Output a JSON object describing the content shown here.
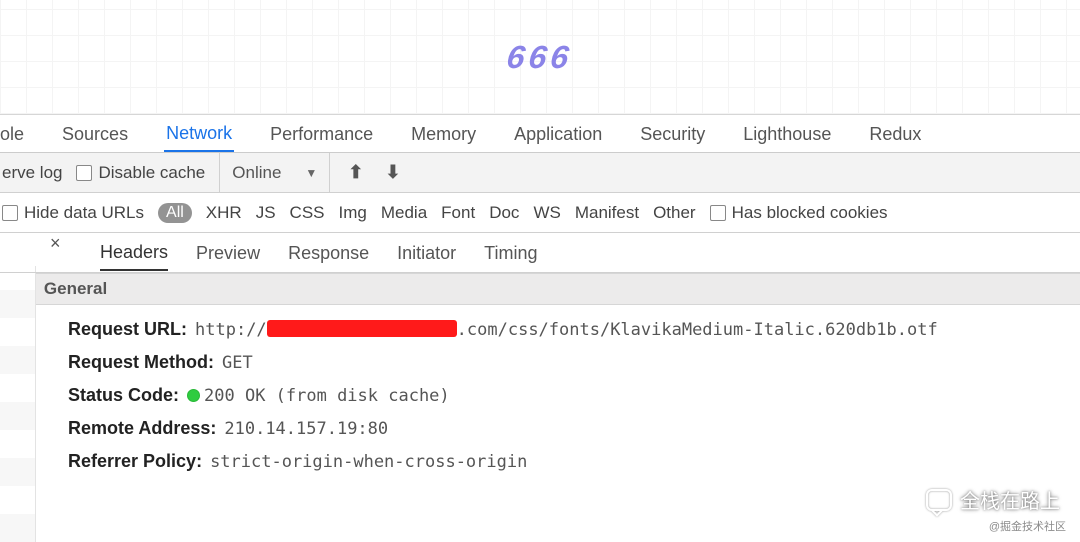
{
  "preview": {
    "text": "666"
  },
  "devtools_tabs": {
    "console_cut": "ole",
    "sources": "Sources",
    "network": "Network",
    "performance": "Performance",
    "memory": "Memory",
    "application": "Application",
    "security": "Security",
    "lighthouse": "Lighthouse",
    "redux": "Redux"
  },
  "toolbar": {
    "preserve_cut": "erve log",
    "disable_cache": "Disable cache",
    "throttling": "Online",
    "upload_icon": "⬆",
    "download_icon": "⬇"
  },
  "filterbar": {
    "hide_data_urls": "Hide data URLs",
    "all": "All",
    "types": [
      "XHR",
      "JS",
      "CSS",
      "Img",
      "Media",
      "Font",
      "Doc",
      "WS",
      "Manifest",
      "Other"
    ],
    "has_blocked": "Has blocked cookies"
  },
  "subtabs": {
    "headers": "Headers",
    "preview": "Preview",
    "response": "Response",
    "initiator": "Initiator",
    "timing": "Timing"
  },
  "section": {
    "general": "General"
  },
  "general": {
    "request_url_label": "Request URL:",
    "request_url_prefix": "http://",
    "request_url_suffix": ".com/css/fonts/KlavikaMedium-Italic.620db1b.otf",
    "request_method_label": "Request Method:",
    "request_method_value": "GET",
    "status_code_label": "Status Code:",
    "status_code_value": "200 OK (from disk cache)",
    "remote_address_label": "Remote Address:",
    "remote_address_value": "210.14.157.19:80",
    "referrer_policy_label": "Referrer Policy:",
    "referrer_policy_value": "strict-origin-when-cross-origin"
  },
  "watermark": {
    "text": "全栈在路上",
    "small": "@掘金技术社区"
  }
}
